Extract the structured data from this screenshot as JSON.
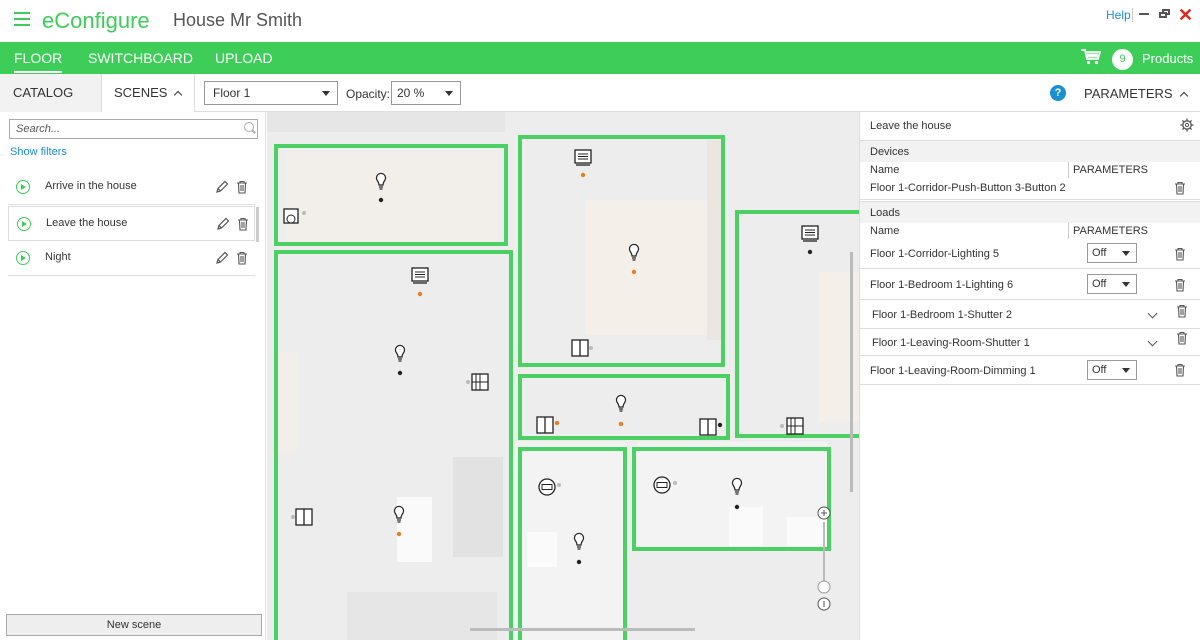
{
  "app": {
    "brand": "eConfigure",
    "project": "House Mr Smith",
    "help": "Help"
  },
  "nav": {
    "tabs": [
      {
        "label": "FLOOR",
        "active": true
      },
      {
        "label": "SWITCHBOARD",
        "active": false
      },
      {
        "label": "UPLOAD",
        "active": false
      }
    ],
    "cart_count": "9",
    "products_label": "Products"
  },
  "toolbar": {
    "catalog_tab": "CATALOG",
    "scenes_tab": "SCENES",
    "floor_select": "Floor 1",
    "opacity_label": "Opacity:",
    "opacity_value": "20 %",
    "help_icon": "?",
    "parameters_tab": "PARAMETERS"
  },
  "left": {
    "search_placeholder": "Search...",
    "show_filters": "Show filters",
    "scenes": [
      {
        "name": "Arrive in the house"
      },
      {
        "name": "Leave the house",
        "selected": true
      },
      {
        "name": "Night"
      }
    ],
    "new_scene": "New scene"
  },
  "right": {
    "title": "Leave the house",
    "devices_section": "Devices",
    "devices_header": {
      "name": "Name",
      "params": "PARAMETERS"
    },
    "devices": [
      {
        "name": "Floor 1-Corridor-Push-Button 3-Button 2"
      }
    ],
    "loads_section": "Loads",
    "loads_header": {
      "name": "Name",
      "params": "PARAMETERS"
    },
    "loads": [
      {
        "name": "Floor 1-Corridor-Lighting 5",
        "value": "Off",
        "control": "select"
      },
      {
        "name": "Floor 1-Bedroom 1-Lighting 6",
        "value": "Off",
        "control": "select"
      },
      {
        "name": "Floor 1-Bedroom 1-Shutter 2",
        "control": "expand"
      },
      {
        "name": "Floor 1-Leaving-Room-Shutter 1",
        "control": "expand"
      },
      {
        "name": "Floor 1-Leaving-Room-Dimming 1",
        "value": "Off",
        "control": "select"
      }
    ]
  },
  "colors": {
    "accent": "#3dcd58",
    "link": "#1a8fd1",
    "close": "#e0241c",
    "device_dot": "#e67e22"
  }
}
